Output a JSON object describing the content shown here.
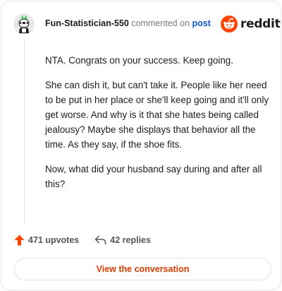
{
  "header": {
    "username": "Fun-Statistician-550",
    "commented_text": "commented on",
    "post_link": "post",
    "logo_text": "reddit",
    "avatar_icon": "snoo-avatar-icon",
    "logo_icon": "reddit-snoo-icon"
  },
  "comment": {
    "paragraphs": [
      "NTA. Congrats on your success. Keep going.",
      "She can dish it, but can't take it. People like her need to be put in her place or she'll keep going and it'll only get worse. And why is it that she hates being called jealousy? Maybe she displays that behavior all the time. As they say, if the shoe fits.",
      "Now, what did your husband say during and after all this?"
    ]
  },
  "actions": {
    "upvotes": "471 upvotes",
    "replies": "42 replies",
    "upvote_icon": "upvote-arrow-icon",
    "reply_icon": "reply-arrow-icon"
  },
  "cta": {
    "label": "View the conversation"
  },
  "colors": {
    "accent": "#ff4500",
    "link": "#0a58ca",
    "cta": "#d93a00"
  }
}
